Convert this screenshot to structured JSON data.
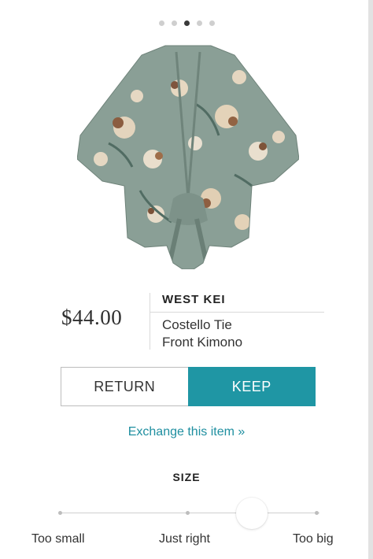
{
  "carousel": {
    "dot_count": 5,
    "active_index": 2
  },
  "product": {
    "image_icon": "floral-kimono-image",
    "price": "$44.00",
    "brand": "WEST KEI",
    "name_line1": "Costello Tie",
    "name_line2": "Front Kimono"
  },
  "actions": {
    "return_label": "RETURN",
    "keep_label": "KEEP",
    "exchange_label": "Exchange this item »"
  },
  "size": {
    "title": "SIZE",
    "options": [
      "Too small",
      "Just right",
      "Too big"
    ],
    "selected_position": 0.75
  },
  "colors": {
    "accent": "#1f96a4",
    "link": "#1f8fa0",
    "kimono_base": "#8a9f96"
  }
}
